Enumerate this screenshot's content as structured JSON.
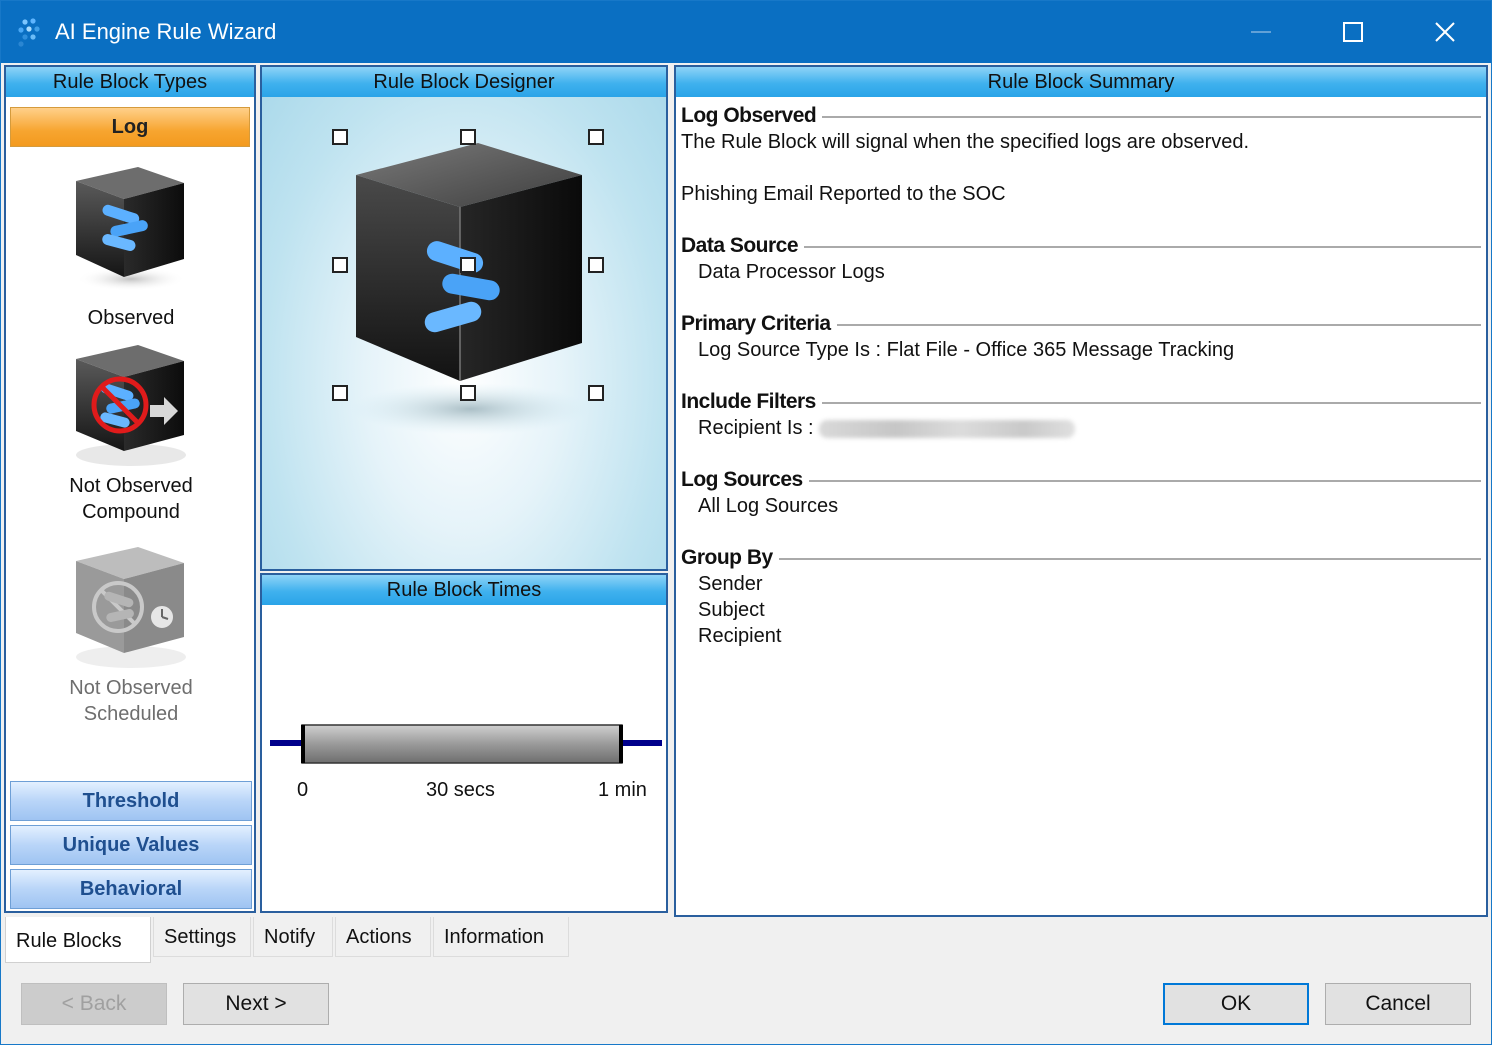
{
  "window": {
    "title": "AI Engine Rule Wizard",
    "controls": [
      "minimize-icon",
      "maximize-icon",
      "close-icon"
    ]
  },
  "left_panel": {
    "header": "Rule Block Types",
    "active_category": "Log",
    "blocks": [
      {
        "label": "Observed",
        "icon": "observed-cube-icon",
        "enabled": true
      },
      {
        "label": "Not Observed Compound",
        "line1": "Not Observed",
        "line2": "Compound",
        "icon": "not-observed-compound-icon",
        "enabled": true
      },
      {
        "label": "Not Observed Scheduled",
        "line1": "Not Observed",
        "line2": "Scheduled",
        "icon": "not-observed-scheduled-icon",
        "enabled": false
      }
    ],
    "categories": [
      "Threshold",
      "Unique Values",
      "Behavioral"
    ]
  },
  "designer": {
    "header": "Rule Block Designer",
    "selected_block_icon": "observed-cube-icon"
  },
  "times": {
    "header": "Rule Block Times",
    "labels": {
      "start": "0",
      "mid": "30 secs",
      "end": "1 min"
    }
  },
  "summary": {
    "header": "Rule Block Summary",
    "log_observed": {
      "heading": "Log Observed",
      "description": "The Rule Block will signal when the specified logs are observed.",
      "name": "Phishing Email Reported to the SOC"
    },
    "data_source": {
      "heading": "Data Source",
      "value": "Data Processor Logs"
    },
    "primary_criteria": {
      "heading": "Primary Criteria",
      "value": "Log Source Type Is : Flat File - Office 365 Message Tracking"
    },
    "include_filters": {
      "heading": "Include Filters",
      "label": "Recipient Is :"
    },
    "log_sources": {
      "heading": "Log Sources",
      "value": "All Log Sources"
    },
    "group_by": {
      "heading": "Group By",
      "values": [
        "Sender",
        "Subject",
        "Recipient"
      ]
    }
  },
  "tabs": [
    "Rule Blocks",
    "Settings",
    "Notify",
    "Actions",
    "Information"
  ],
  "active_tab": "Rule Blocks",
  "buttons": {
    "back": "< Back",
    "next": "Next >",
    "ok": "OK",
    "cancel": "Cancel"
  },
  "colors": {
    "titlebar": "#0a6fc2",
    "panel_header": "#3fb1ee",
    "active_category": "#f7a530",
    "category_button": "#b9d5f8",
    "panel_border": "#2a5f9e",
    "timeline_track": "#00008b"
  }
}
